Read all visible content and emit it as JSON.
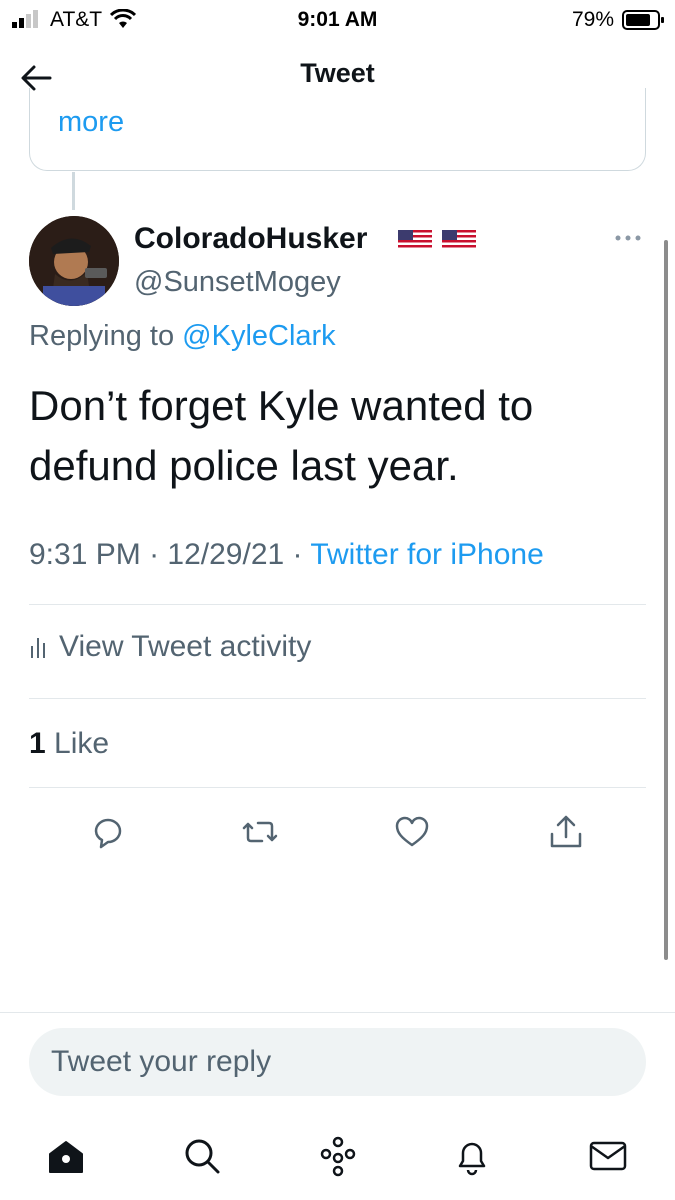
{
  "status_bar": {
    "carrier": "AT&T",
    "time": "9:01 AM",
    "battery": "79%"
  },
  "header": {
    "title": "Tweet"
  },
  "quoted_card": {
    "more_label": "more"
  },
  "tweet": {
    "display_name": "ColoradoHusker",
    "flags": "🇺🇸 🇺🇸",
    "handle": "@SunsetMogey",
    "replying_prefix": "Replying to",
    "replying_to": "@KyleClark",
    "text": "Don’t forget Kyle wanted to defund police last year.",
    "time": "9:31 PM",
    "date": "12/29/21",
    "source": "Twitter for iPhone",
    "activity_label": "View Tweet activity",
    "like_count": "1",
    "like_label": "Like"
  },
  "actions": [
    "reply-icon",
    "retweet-icon",
    "like-icon",
    "share-icon"
  ],
  "reply_bar": {
    "placeholder": "Tweet your reply"
  },
  "bottom_nav": [
    "home-icon",
    "search-icon",
    "spaces-icon",
    "notifications-icon",
    "messages-icon"
  ],
  "colors": {
    "accent": "#1d9bf0",
    "text": "#0f1419",
    "secondary": "#536471",
    "border": "#cfd9de"
  }
}
